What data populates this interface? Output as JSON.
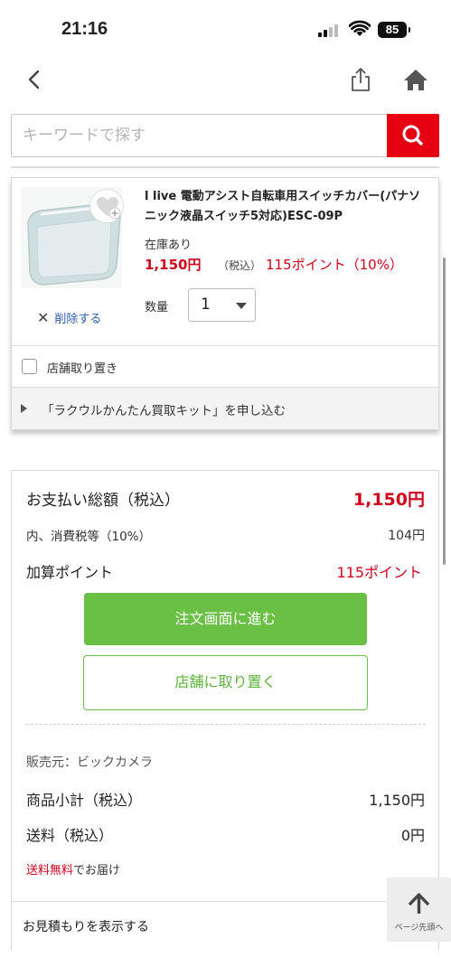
{
  "status_bar": {
    "time": "21:16",
    "battery": "85"
  },
  "search": {
    "placeholder": "キーワードで探す"
  },
  "cart_item": {
    "name": "l live 電動アシスト自転車用スイッチカバー(パナソニック液晶スイッチ5対応)ESC-09P",
    "stock": "在庫あり",
    "price": "1,150円",
    "tax_note": "（税込）",
    "points": "115ポイント（10%）",
    "delete_label": "削除する",
    "quantity_label": "数量",
    "quantity_value": "1",
    "store_pickup_label": "店舗取り置き",
    "kit_label": "「ラクウルかんたん買取キット」を申し込む"
  },
  "summary": {
    "total_label": "お支払い総額（税込）",
    "total_value": "1,150円",
    "tax_label": "内、消費税等（10%）",
    "tax_value": "104円",
    "points_label": "加算ポイント",
    "points_value": "115ポイント",
    "order_button": "注文画面に進む",
    "store_button": "店舗に取り置く",
    "seller": "販売元：ビックカメラ",
    "subtotal_label": "商品小計（税込）",
    "subtotal_value": "1,150円",
    "shipping_label": "送料（税込）",
    "shipping_value": "0円",
    "free_shipping_red": "送料無料",
    "free_shipping_rest": "でお届け",
    "estimate_label": "お見積もりを表示する"
  },
  "scroll_top_label": "ページ先頭へ",
  "colors": {
    "brand_red": "#e60012",
    "price_red": "#d0021b",
    "green": "#6abf45"
  }
}
